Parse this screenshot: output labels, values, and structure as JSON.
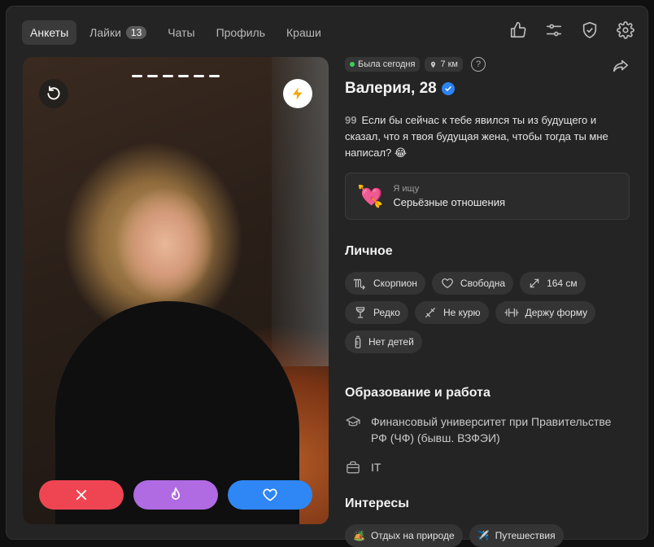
{
  "nav": {
    "tabs": [
      {
        "label": "Анкеты",
        "active": true
      },
      {
        "label": "Лайки",
        "badge": "13"
      },
      {
        "label": "Чаты"
      },
      {
        "label": "Профиль"
      },
      {
        "label": "Краши"
      }
    ],
    "icons": [
      "thumbs-up-icon",
      "filters-icon",
      "shield-icon",
      "gear-icon"
    ]
  },
  "photo": {
    "progress_segments": 6,
    "actions": [
      "dislike-icon (x)",
      "super-like-icon (flame)",
      "like-icon (heart)"
    ]
  },
  "profile": {
    "status": "Была сегодня",
    "distance": "7 км",
    "help": "?",
    "name": "Валерия, 28",
    "bio_quote_mark": "99",
    "bio": "Если бы сейчас к тебе явился ты из будущего и сказал, что я твоя будущая жена, чтобы тогда ты мне написал? 😂",
    "looking_for": {
      "emoji": "💘",
      "label": "Я ищу",
      "value": "Серьёзные отношения"
    }
  },
  "personal": {
    "title": "Личное",
    "tags": [
      {
        "icon": "scorpio-icon",
        "label": "Скорпион"
      },
      {
        "icon": "heart-outline-icon",
        "label": "Свободна"
      },
      {
        "icon": "height-arrows-icon",
        "label": "164 см"
      },
      {
        "icon": "wine-glass-icon",
        "label": "Редко"
      },
      {
        "icon": "no-smoking-icon",
        "label": "Не курю"
      },
      {
        "icon": "dumbbell-icon",
        "label": "Держу форму"
      },
      {
        "icon": "baby-bottle-icon",
        "label": "Нет детей"
      }
    ]
  },
  "education": {
    "title": "Образование и работа",
    "university": "Финансовый университет при Правительстве РФ (ЧФ) (бывш. ВЗФЭИ)",
    "job": "IT"
  },
  "interests": {
    "title": "Интересы",
    "tags": [
      {
        "emoji": "🏕️",
        "label": "Отдых на природе"
      },
      {
        "emoji": "✈️",
        "label": "Путешествия"
      }
    ]
  }
}
